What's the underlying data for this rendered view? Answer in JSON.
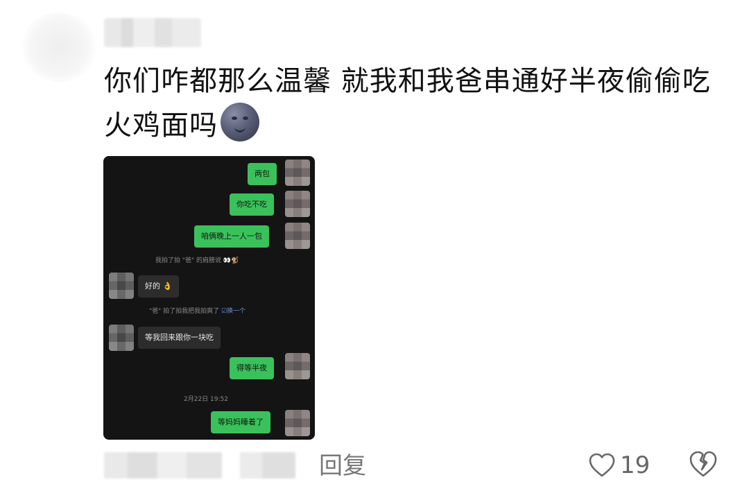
{
  "comment": {
    "text": "你们咋都那么温馨 就我和我爸串通好半夜偷偷吃火鸡面吗",
    "emoji": "new-moon-face-emoji"
  },
  "chat": {
    "messages": [
      {
        "side": "out",
        "text": "两包"
      },
      {
        "side": "out",
        "text": "你吃不吃"
      },
      {
        "side": "out",
        "text": "咱俩晚上一人一包"
      },
      {
        "side": "in",
        "text": "好的"
      },
      {
        "side": "in",
        "text": "等我回来跟你一块吃"
      },
      {
        "side": "out",
        "text": "得等半夜"
      },
      {
        "side": "out",
        "text": "等妈妈睡着了"
      }
    ],
    "system1": "我拍了拍 \"爸\" 的肩膀说",
    "system2": "\"爸\" 拍了拍我把我拍爽了",
    "system2_link": "换一个",
    "timestamp": "2月22日 19:52"
  },
  "footer": {
    "reply_label": "回复",
    "like_count": "19"
  },
  "colors": {
    "chat_bg": "#141414",
    "outgoing_bubble": "#3bc15c",
    "incoming_bubble": "#2c2c2c"
  }
}
